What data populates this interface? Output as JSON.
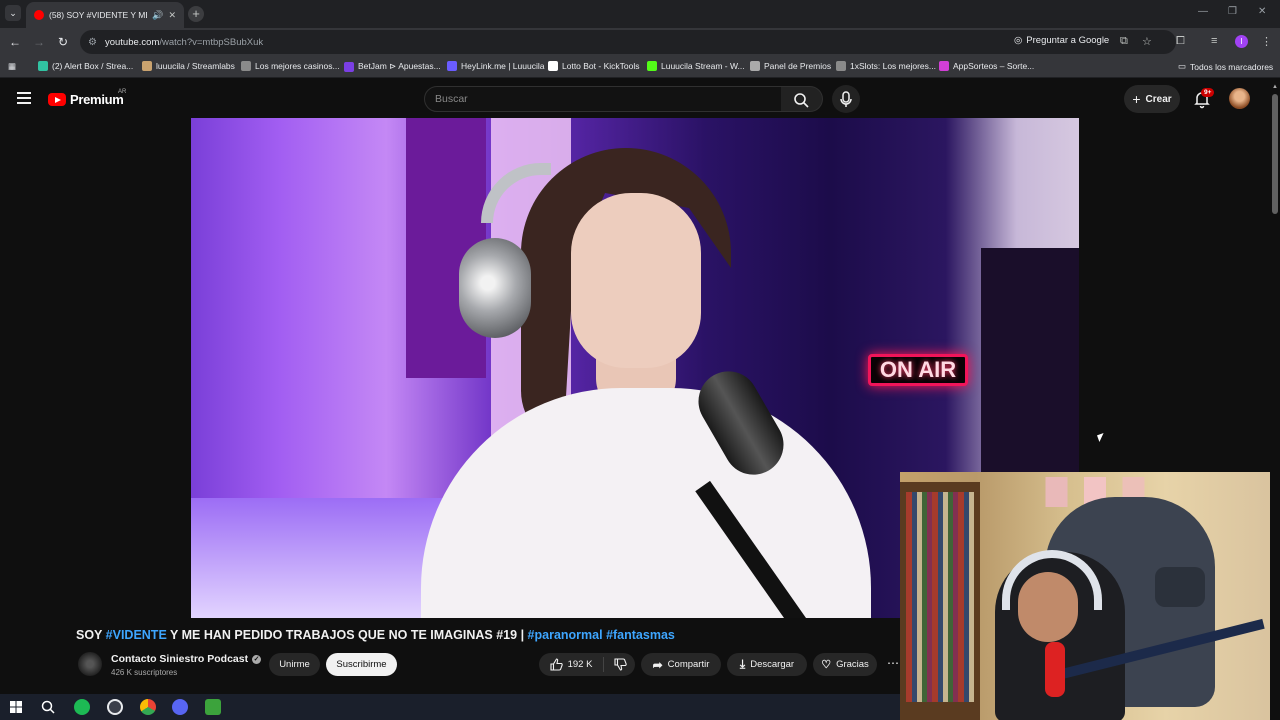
{
  "browser": {
    "tab_title": "(58) SOY #VIDENTE Y ME H",
    "url_host": "youtube.com",
    "url_path": "/watch?v=mtbpSBubXuk",
    "ask_google": "Preguntar a Google",
    "profile_initial": "I"
  },
  "bookmarks": [
    {
      "label": "(2) Alert Box / Strea...",
      "color": "#31c3a2"
    },
    {
      "label": "luuucila / Streamlabs",
      "color": "#caa36f"
    },
    {
      "label": "Los mejores casinos...",
      "color": "#8a8a8a"
    },
    {
      "label": "BetJam ⊳ Apuestas...",
      "color": "#7b3fe4"
    },
    {
      "label": "HeyLink.me | Luuucila",
      "color": "#6a5cff"
    },
    {
      "label": "Lotto Bot - KickTools",
      "color": "#ffffff"
    },
    {
      "label": "Luuucila Stream - W...",
      "color": "#53fc18"
    },
    {
      "label": "Panel de Premios",
      "color": "#aaaaaa"
    },
    {
      "label": "1xSlots: Los mejores...",
      "color": "#8a8a8a"
    },
    {
      "label": "AppSorteos – Sorte...",
      "color": "#d23fd6"
    }
  ],
  "bookmarks_all": "Todos los marcadores",
  "youtube": {
    "logo_word": "Premium",
    "country_code": "AR",
    "search_placeholder": "Buscar",
    "create_label": "Crear",
    "notification_badge": "9+"
  },
  "video": {
    "onair_text": "ON AIR",
    "title_parts": [
      {
        "text": "SOY ",
        "tag": false
      },
      {
        "text": "#VIDENTE",
        "tag": true
      },
      {
        "text": " Y ME HAN PEDIDO TRABAJOS QUE NO TE IMAGINAS #19 | ",
        "tag": false
      },
      {
        "text": "#paranormal",
        "tag": true
      },
      {
        "text": " ",
        "tag": false
      },
      {
        "text": "#fantasmas",
        "tag": true
      }
    ],
    "channel_name": "Contacto Siniestro Podcast",
    "subscribers": "426 K suscriptores",
    "join_label": "Unirme",
    "subscribe_label": "Suscribirme",
    "like_count": "192 K",
    "share_label": "Compartir",
    "download_label": "Descargar",
    "thanks_label": "Gracias"
  },
  "colors": {
    "brand_red": "#ff0000",
    "hashtag_blue": "#3ea6ff",
    "bg": "#0f0f0f"
  }
}
